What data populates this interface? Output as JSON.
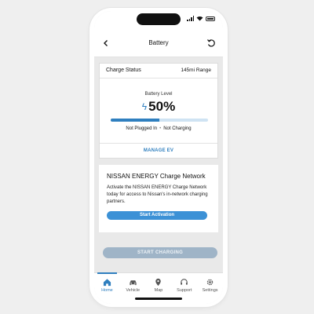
{
  "header": {
    "title": "Battery"
  },
  "charge_card": {
    "status_label": "Charge Status",
    "range": "145mi Range",
    "battery_level_label": "Battery Level",
    "percent_text": "50%",
    "level_fraction": 0.5,
    "plug_status": "Not Plugged In",
    "charge_state": "Not Charging",
    "manage_label": "MANAGE EV"
  },
  "network_card": {
    "title": "NISSAN ENERGY Charge Network",
    "body": "Activate the NISSAN ENERGY Charge Network today for access to Nissan's in-network charging partners.",
    "button_label": "Start Activation"
  },
  "start_charging_label": "START CHARGING",
  "tabs": [
    {
      "label": "Home",
      "icon": "home-icon"
    },
    {
      "label": "Vehicle",
      "icon": "car-icon"
    },
    {
      "label": "Map",
      "icon": "map-pin-icon"
    },
    {
      "label": "Support",
      "icon": "headset-icon"
    },
    {
      "label": "Settings",
      "icon": "gear-icon"
    }
  ],
  "colors": {
    "accent": "#2f7fbf",
    "button": "#3c91d6",
    "disabled": "#9fb4c7"
  }
}
